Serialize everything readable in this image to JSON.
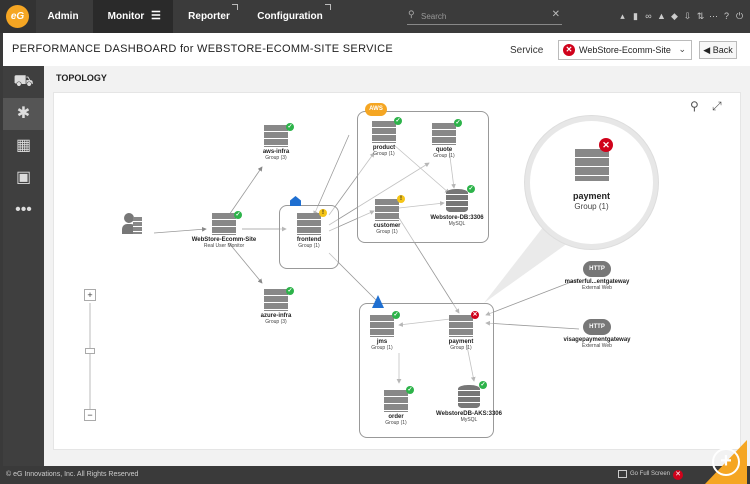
{
  "topbar": {
    "logo_text": "eG",
    "nav": [
      {
        "label": "Admin"
      },
      {
        "label": "Monitor"
      },
      {
        "label": "Reporter"
      },
      {
        "label": "Configuration"
      }
    ],
    "search_placeholder": "Search"
  },
  "header": {
    "title": "PERFORMANCE DASHBOARD for WEBSTORE-ECOMM-SITE SERVICE",
    "service_label": "Service",
    "service_value": "WebStore-Ecomm-Site",
    "back_label": "Back"
  },
  "section_title": "TOPOLOGY",
  "groups": {
    "aws_badge": "AWS",
    "http_badge": "HTTP"
  },
  "nodes": {
    "aws_infra": {
      "name": "aws-infra",
      "sub": "Group (3)",
      "status": "ok"
    },
    "azure_infra": {
      "name": "azure-infra",
      "sub": "Group (3)",
      "status": "ok"
    },
    "site": {
      "name": "WebStore-Ecomm-Site",
      "sub": "Real User Monitor",
      "status": "ok"
    },
    "frontend": {
      "name": "frontend",
      "sub": "Group (1)",
      "status": "warn"
    },
    "product": {
      "name": "product",
      "sub": "Group (1)",
      "status": "ok"
    },
    "quote": {
      "name": "quote",
      "sub": "Group (1)",
      "status": "ok"
    },
    "customer": {
      "name": "customer",
      "sub": "Group (1)",
      "status": "warn"
    },
    "webstore_db": {
      "name": "Webstore-DB:3306",
      "sub": "MySQL",
      "status": "ok"
    },
    "jms": {
      "name": "jms",
      "sub": "Group (1)",
      "status": "ok"
    },
    "payment": {
      "name": "payment",
      "sub": "Group (1)",
      "status": "err"
    },
    "order": {
      "name": "order",
      "sub": "Group (1)",
      "status": "ok"
    },
    "webstore_db_aks": {
      "name": "WebstoreDB-AKS:3306",
      "sub": "MySQL",
      "status": "ok"
    },
    "masterful": {
      "name": "masterful...entgateway",
      "sub": "External Web"
    },
    "visage": {
      "name": "visagepaymentgateway",
      "sub": "External Web"
    }
  },
  "bubble": {
    "name": "payment",
    "sub": "Group (1)"
  },
  "footer": {
    "copyright": "© eG Innovations, Inc. All Rights Reserved",
    "fullscreen": "Go Full Screen"
  },
  "colors": {
    "ok": "#2db34a",
    "warn": "#f5c518",
    "err": "#d0021b",
    "accent": "#f5a623"
  }
}
